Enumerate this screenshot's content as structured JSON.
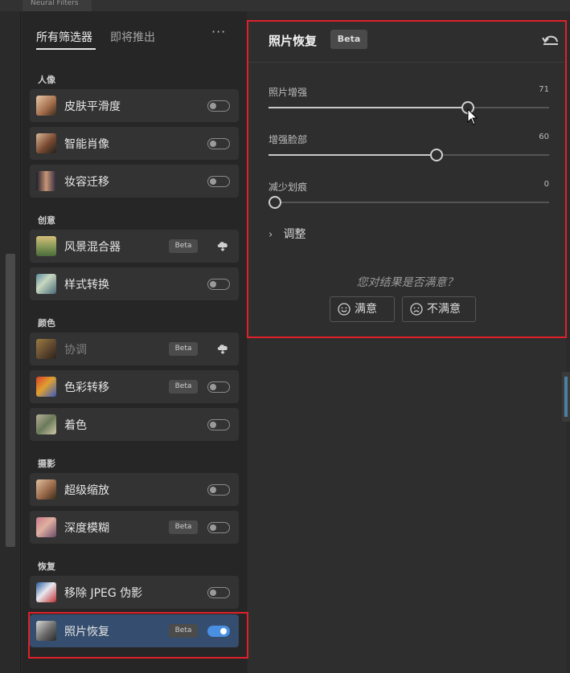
{
  "window": {
    "tab_label": "Neural Filters"
  },
  "filter_panel": {
    "tabs": {
      "all": "所有筛选器",
      "coming": "即将推出",
      "more": "···"
    },
    "sections": [
      {
        "title": "人像",
        "items": [
          {
            "label": "皮肤平滑度",
            "badge": "",
            "control": "toggle",
            "on": false,
            "disabled": false
          },
          {
            "label": "智能肖像",
            "badge": "",
            "control": "toggle",
            "on": false,
            "disabled": false
          },
          {
            "label": "妆容迁移",
            "badge": "",
            "control": "toggle",
            "on": false,
            "disabled": false
          }
        ]
      },
      {
        "title": "创意",
        "items": [
          {
            "label": "风景混合器",
            "badge": "Beta",
            "control": "cloud",
            "on": false,
            "disabled": false
          },
          {
            "label": "样式转换",
            "badge": "",
            "control": "toggle",
            "on": false,
            "disabled": false
          }
        ]
      },
      {
        "title": "颜色",
        "items": [
          {
            "label": "协调",
            "badge": "Beta",
            "control": "cloud",
            "on": false,
            "disabled": true
          },
          {
            "label": "色彩转移",
            "badge": "Beta",
            "control": "toggle",
            "on": false,
            "disabled": false
          },
          {
            "label": "着色",
            "badge": "",
            "control": "toggle",
            "on": false,
            "disabled": false
          }
        ]
      },
      {
        "title": "摄影",
        "items": [
          {
            "label": "超级缩放",
            "badge": "",
            "control": "toggle",
            "on": false,
            "disabled": false
          },
          {
            "label": "深度模糊",
            "badge": "Beta",
            "control": "toggle",
            "on": false,
            "disabled": false
          }
        ]
      },
      {
        "title": "恢复",
        "items": [
          {
            "label": "移除 JPEG 伪影",
            "badge": "",
            "control": "toggle",
            "on": false,
            "disabled": false
          },
          {
            "label": "照片恢复",
            "badge": "Beta",
            "control": "toggle",
            "on": true,
            "disabled": false,
            "selected": true
          }
        ]
      }
    ]
  },
  "detail_panel": {
    "title": "照片恢复",
    "badge": "Beta",
    "sliders": [
      {
        "label": "照片增强",
        "value": 71,
        "max": 100
      },
      {
        "label": "增强脸部",
        "value": 60,
        "max": 100
      },
      {
        "label": "减少划痕",
        "value": 0,
        "max": 100
      }
    ],
    "adjust_label": "调整",
    "feedback_question": "您对结果是否满意？",
    "satisfied_label": "满意",
    "unsatisfied_label": "不满意"
  },
  "colors": {
    "accent": "#4a90e2",
    "highlight_box": "#e0202a",
    "selected_row": "#354d6e"
  },
  "icons": [
    "undo-icon",
    "cloud-download-icon",
    "chevron-right-icon",
    "smile-icon",
    "frown-icon",
    "ellipsis-icon"
  ]
}
